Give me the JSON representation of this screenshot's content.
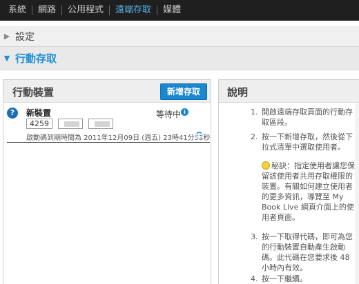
{
  "topnav": {
    "items": [
      {
        "label": "系統",
        "active": false
      },
      {
        "label": "網路",
        "active": false
      },
      {
        "label": "公用程式",
        "active": false
      },
      {
        "label": "遠端存取",
        "active": true
      },
      {
        "label": "媒體",
        "active": false
      }
    ],
    "active_color": "#5ab4ea"
  },
  "breadcrumb": {
    "settings_label": "設定",
    "section_label": "行動存取"
  },
  "devices_panel": {
    "title": "行動裝置",
    "add_button_label": "新增存取",
    "device": {
      "name": "新裝置",
      "status": "等待中",
      "code_visible_part": "4259",
      "expiration_text": "啟動碼到期時間為 2011年12月09日 (週五) 23時41分53秒"
    }
  },
  "help_panel": {
    "title": "說明",
    "steps": [
      {
        "num": "1.",
        "text": "開啟遠端存取頁面的行動存取區段。"
      },
      {
        "num": "2.",
        "text": "按一下新增存取，然後從下拉式清單中選取使用者。"
      },
      {
        "num": "3.",
        "text": "按一下取得代碼，即可為您的行動裝置自動產生啟動碼。此代碼在您要求後 48 小時內有效。"
      },
      {
        "num": "4.",
        "text": "按一下繼續。"
      }
    ],
    "tip": "秘訣：指定使用者讓您保留該使用者共用存取權限的裝置。有關如何建立使用者的更多資訊，導覽至 My Book Live 網頁介面上的使用者頁面。"
  },
  "colors": {
    "accent": "#1a87cf",
    "nav_bg": "#1f1f1f"
  }
}
